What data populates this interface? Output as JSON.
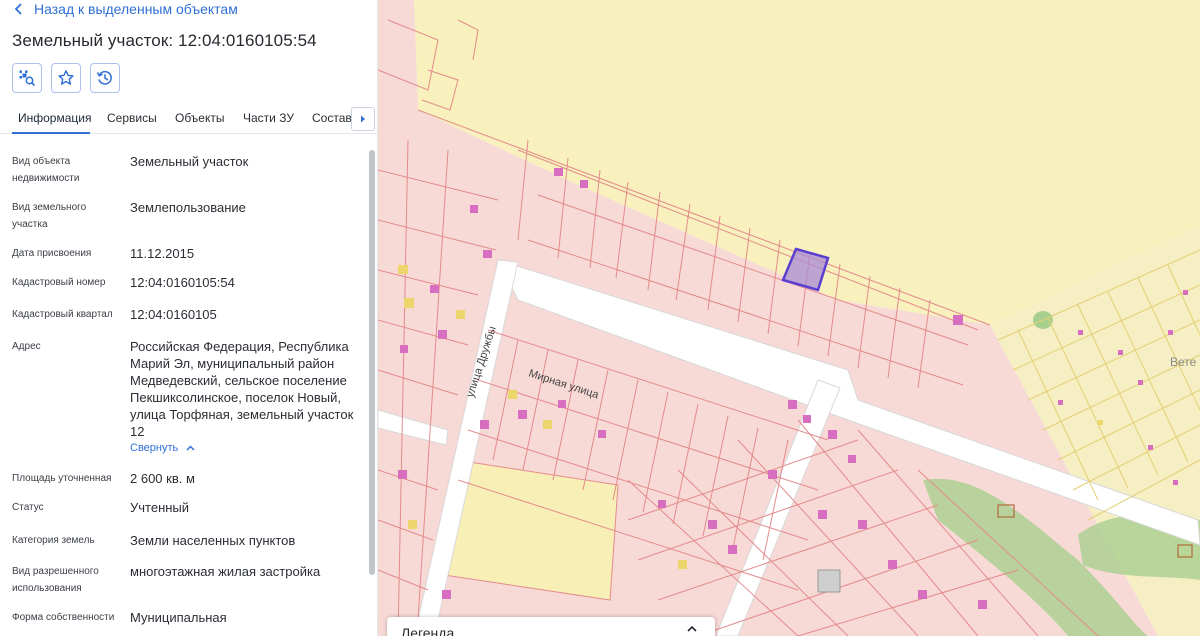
{
  "header": {
    "back_label": "Назад к выделенным объектам",
    "title": "Земельный участок: 12:04:0160105:54"
  },
  "tools": [
    {
      "icon": "select-area-icon"
    },
    {
      "icon": "star-icon"
    },
    {
      "icon": "history-icon"
    }
  ],
  "tabs": [
    {
      "label": "Информация",
      "active": true
    },
    {
      "label": "Сервисы"
    },
    {
      "label": "Объекты"
    },
    {
      "label": "Части ЗУ"
    },
    {
      "label": "Состав"
    }
  ],
  "fields": [
    {
      "label": "Вид объекта недвижимости",
      "value": "Земельный участок"
    },
    {
      "label": "Вид земельного участка",
      "value": "Землепользование"
    },
    {
      "label": "Дата присвоения",
      "value": "11.12.2015"
    },
    {
      "label": "Кадастровый номер",
      "value": "12:04:0160105:54"
    },
    {
      "label": "Кадастровый квартал",
      "value": "12:04:0160105"
    },
    {
      "label": "Адрес",
      "value": "Российская Федерация, Республика Марий Эл, муниципальный район Медведевский, сельское поселение Пекшиксолинское, поселок Новый, улица Торфяная, земельный участок 12"
    },
    {
      "label": "Площадь уточненная",
      "value": "2 600 кв. м"
    },
    {
      "label": "Статус",
      "value": "Учтенный"
    },
    {
      "label": "Категория земель",
      "value": "Земли населенных пунктов"
    },
    {
      "label": "Вид разрешенного использования",
      "value": "многоэтажная жилая застройка"
    },
    {
      "label": "Форма собственности",
      "value": "Муниципальная"
    }
  ],
  "collapse_label": "Свернуть",
  "map": {
    "street_1": "улица Дружбы",
    "street_2": "Мирная улица",
    "place_label": "Вете"
  },
  "legend": {
    "title": "Легенда"
  },
  "colors": {
    "accent": "#2f6fd6",
    "selected_parcel": "#5a3fd0",
    "parcel_line": "#e38b8b",
    "parcel_fill": "#f7d9d6",
    "empty_land": "#f8f0bd"
  }
}
